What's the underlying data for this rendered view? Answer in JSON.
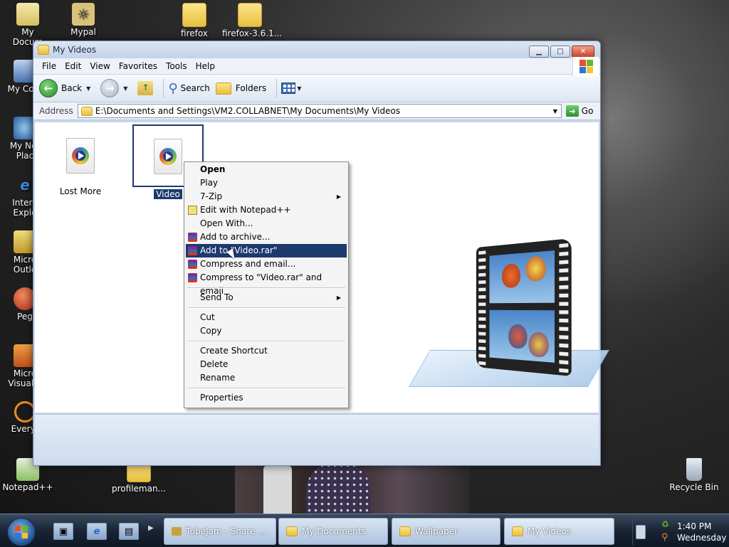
{
  "desktop": {
    "icons": [
      {
        "label": "My\nDocum"
      },
      {
        "label": "Mypal"
      },
      {
        "label": "firefox"
      },
      {
        "label": "firefox-3.6.1..."
      },
      {
        "label": "My Com"
      },
      {
        "label": "My Net\nPlac"
      },
      {
        "label": "Intern\nExplo"
      },
      {
        "label": "Micro\nOutlo"
      },
      {
        "label": "Peg"
      },
      {
        "label": "Micro\nVisual S"
      },
      {
        "label": "Everyt"
      },
      {
        "label": "Notepad++"
      },
      {
        "label": "profileman..."
      },
      {
        "label": "Recycle Bin"
      }
    ]
  },
  "window": {
    "title": "My Videos",
    "menu": [
      "File",
      "Edit",
      "View",
      "Favorites",
      "Tools",
      "Help"
    ],
    "toolbar": {
      "back": "Back",
      "search": "Search",
      "folders": "Folders"
    },
    "address": {
      "label": "Address",
      "path": "E:\\Documents and Settings\\VM2.COLLABNET\\My Documents\\My Videos",
      "go": "Go"
    },
    "files": [
      {
        "name": "Lost More",
        "selected": false
      },
      {
        "name": "Video",
        "selected": true
      }
    ]
  },
  "context_menu": {
    "items": [
      {
        "label": "Open",
        "bold": true
      },
      {
        "label": "Play"
      },
      {
        "label": "7-Zip",
        "submenu": true
      },
      {
        "label": "Edit with Notepad++",
        "icon": "notepad-icon"
      },
      {
        "label": "Open With..."
      },
      {
        "label": "Add to archive...",
        "icon": "winrar-icon"
      },
      {
        "label": "Add to \"Video.rar\"",
        "icon": "winrar-icon",
        "highlighted": true
      },
      {
        "label": "Compress and email...",
        "icon": "winrar-icon"
      },
      {
        "label": "Compress to \"Video.rar\" and email",
        "icon": "winrar-icon"
      },
      {
        "label": "Send To",
        "submenu": true
      },
      {
        "label": "Cut"
      },
      {
        "label": "Copy"
      },
      {
        "label": "Create Shortcut"
      },
      {
        "label": "Delete"
      },
      {
        "label": "Rename"
      },
      {
        "label": "Properties"
      }
    ]
  },
  "taskbar": {
    "buttons": [
      "TubeJam - Share ...",
      "My Documents",
      "Wallpaper",
      "My Videos"
    ],
    "active": "My Videos",
    "clock": {
      "time": "1:40 PM",
      "day": "Wednesday"
    }
  },
  "colors": {
    "selection": "#1c3a6e",
    "titlebar": "#c4d3e8"
  }
}
